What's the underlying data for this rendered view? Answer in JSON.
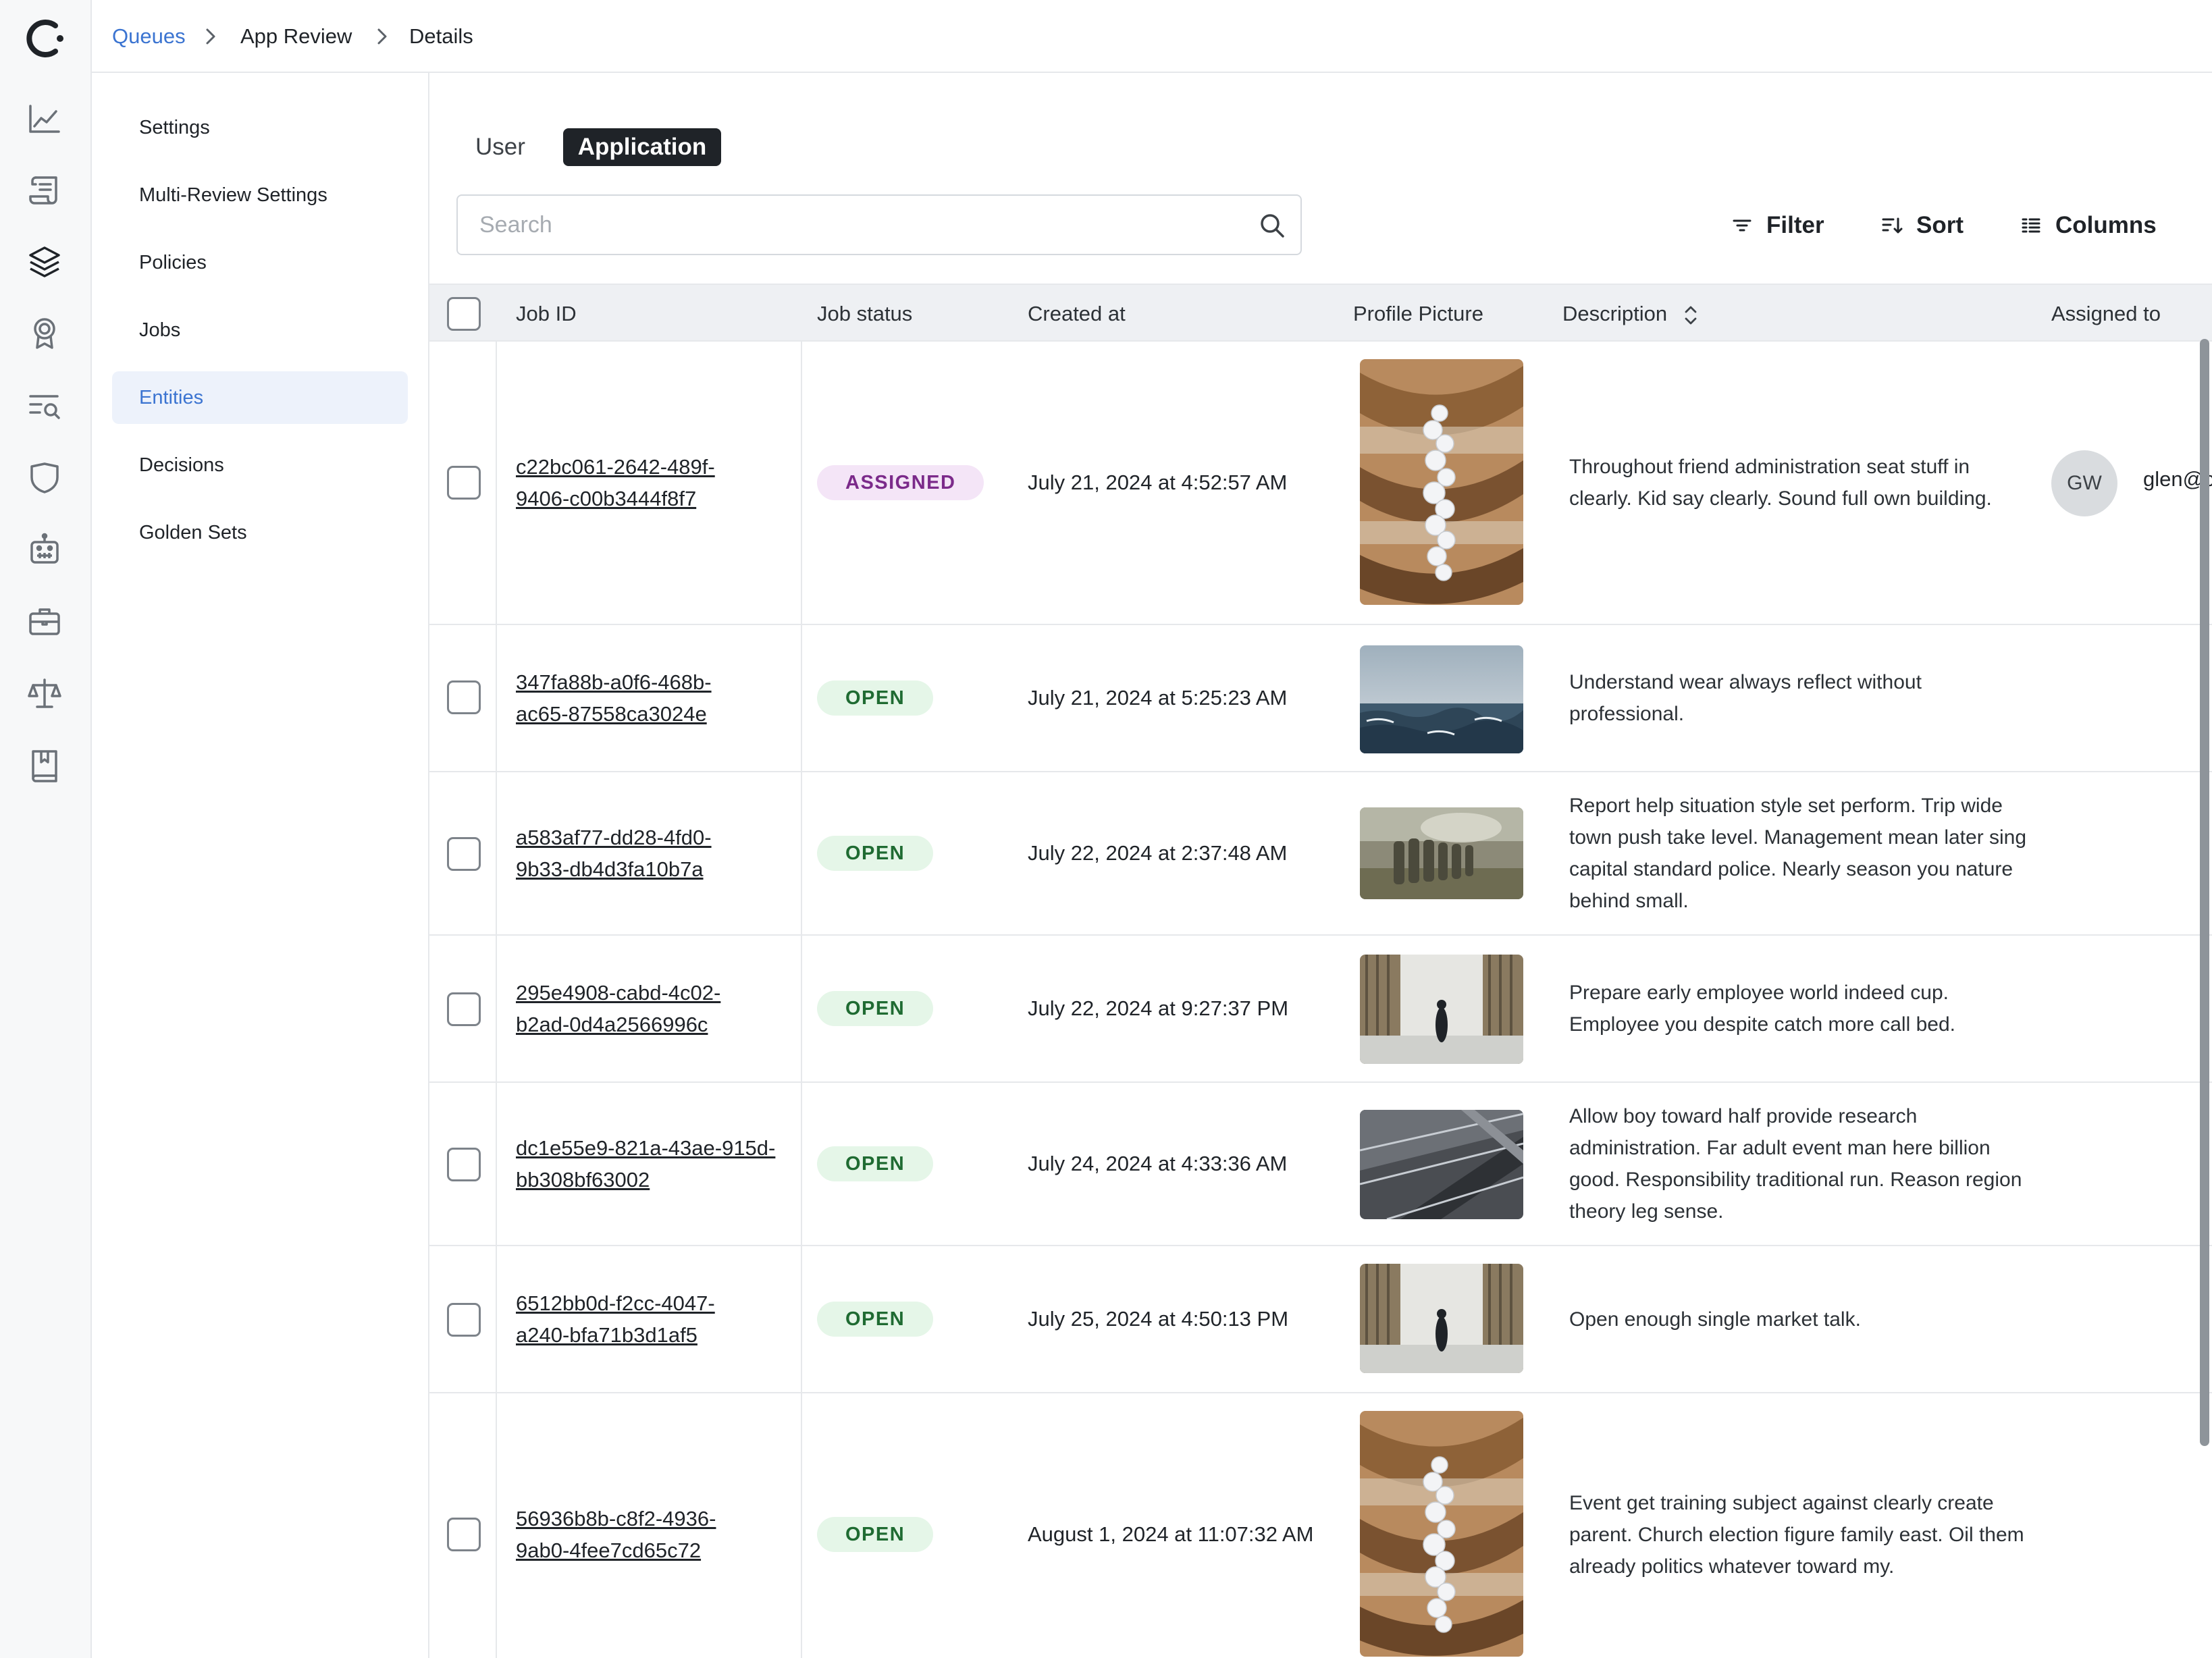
{
  "breadcrumb": {
    "root": "Queues",
    "queue": "App Review",
    "current": "Details"
  },
  "settings_nav": {
    "items": [
      {
        "label": "Settings"
      },
      {
        "label": "Multi-Review Settings"
      },
      {
        "label": "Policies"
      },
      {
        "label": "Jobs"
      },
      {
        "label": "Entities",
        "active": true
      },
      {
        "label": "Decisions"
      },
      {
        "label": "Golden Sets"
      }
    ]
  },
  "rail_icons": [
    "logo-icon",
    "chart-icon",
    "scroll-icon",
    "layers-icon",
    "award-icon",
    "search-list-icon",
    "shield-icon",
    "robot-icon",
    "briefcase-icon",
    "scale-icon",
    "book-icon"
  ],
  "tabs": {
    "user": "User",
    "application": "Application",
    "selected": "Application"
  },
  "search": {
    "placeholder": "Search",
    "value": ""
  },
  "toolbar": {
    "filter": "Filter",
    "sort": "Sort",
    "columns": "Columns"
  },
  "table": {
    "columns": {
      "job_id": "Job ID",
      "job_status": "Job status",
      "created_at": "Created at",
      "profile_picture": "Profile Picture",
      "description": "Description",
      "assigned_to": "Assigned to"
    },
    "rows": [
      {
        "job_id_line1": "c22bc061-2642-489f-",
        "job_id_line2": "9406-c00b3444f8f7",
        "status": "ASSIGNED",
        "created": "July 21, 2024 at 4:52:57 AM",
        "picture": "stairwell-balloons",
        "description": "Throughout friend administration seat stuff in clearly. Kid say clearly. Sound full own building.",
        "assignee_initials": "GW",
        "assignee": "glen@c"
      },
      {
        "job_id_line1": "347fa88b-a0f6-468b-",
        "job_id_line2": "ac65-87558ca3024e",
        "status": "OPEN",
        "created": "July 21, 2024 at 5:25:23 AM",
        "picture": "ocean-waves",
        "description": "Understand wear always reflect without professional."
      },
      {
        "job_id_line1": "a583af77-dd28-4fd0-",
        "job_id_line2": "9b33-db4d3fa10b7a",
        "status": "OPEN",
        "created": "July 22, 2024 at 2:37:48 AM",
        "picture": "soldiers-field",
        "description": "Report help situation style set perform. Trip wide town push take level. Management mean later sing capital standard police. Nearly season you nature behind small."
      },
      {
        "job_id_line1": "295e4908-cabd-4c02-",
        "job_id_line2": "b2ad-0d4a2566996c",
        "status": "OPEN",
        "created": "July 22, 2024 at 9:27:37 PM",
        "picture": "columns-figure",
        "description": "Prepare early employee world indeed cup. Employee you despite catch more call bed."
      },
      {
        "job_id_line1": "dc1e55e9-821a-43ae-915d-",
        "job_id_line2": "bb308bf63002",
        "status": "OPEN",
        "created": "July 24, 2024 at 4:33:36 AM",
        "picture": "concrete-ceiling",
        "description": "Allow boy toward half provide research administration. Far adult event man here billion good. Responsibility traditional run. Reason region theory leg sense."
      },
      {
        "job_id_line1": "6512bb0d-f2cc-4047-",
        "job_id_line2": "a240-bfa71b3d1af5",
        "status": "OPEN",
        "created": "July 25, 2024 at 4:50:13 PM",
        "picture": "columns-figure",
        "description": "Open enough single market talk."
      },
      {
        "job_id_line1": "56936b8b-c8f2-4936-",
        "job_id_line2": "9ab0-4fee7cd65c72",
        "status": "OPEN",
        "created": "August 1, 2024 at 11:07:32 AM",
        "picture": "stairwell-balloons",
        "description": "Event get training subject against clearly create parent. Church election figure family east. Oil them already politics whatever toward my."
      }
    ]
  },
  "colors": {
    "link": "#3b74d1",
    "active_bg": "#edf2fb",
    "assigned_bg": "#f4e5f7",
    "assigned_text": "#7b2a8a",
    "open_bg": "#e5f6e8",
    "open_text": "#1f6b32",
    "dark_tab": "#1f2328"
  }
}
